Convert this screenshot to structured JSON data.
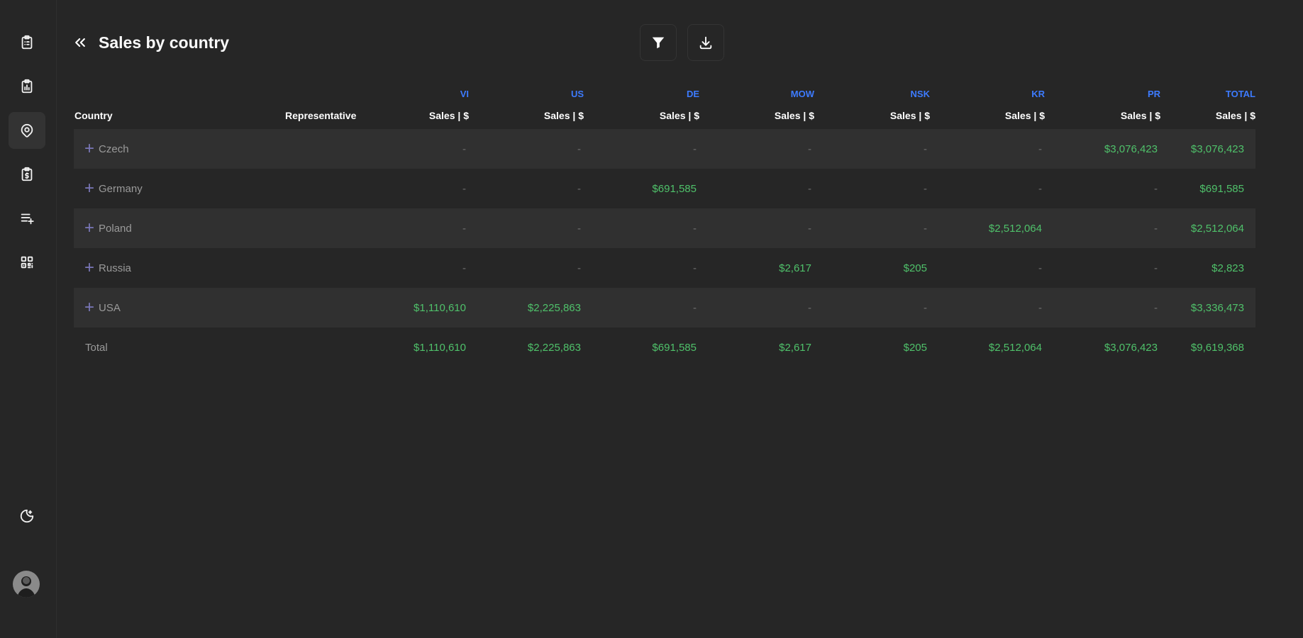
{
  "page": {
    "title": "Sales by country"
  },
  "sidebar": {
    "items": [
      {
        "icon": "clipboard-list-icon"
      },
      {
        "icon": "clipboard-chart-icon"
      },
      {
        "icon": "map-pin-icon",
        "active": true
      },
      {
        "icon": "clipboard-dollar-icon"
      },
      {
        "icon": "playlist-add-icon"
      },
      {
        "icon": "qr-code-icon"
      }
    ],
    "bottom": [
      {
        "icon": "moon-star-icon"
      }
    ]
  },
  "toolbar": {
    "filter_icon": "filter-icon",
    "download_icon": "download-icon"
  },
  "table": {
    "group_headers": [
      "VI",
      "US",
      "DE",
      "MOW",
      "NSK",
      "KR",
      "PR",
      "TOTAL"
    ],
    "country_header": "Country",
    "representative_header": "Representative",
    "measure_header": "Sales | $",
    "rows": [
      {
        "country": "Czech",
        "values": [
          "-",
          "-",
          "-",
          "-",
          "-",
          "-",
          "$3,076,423",
          "$3,076,423"
        ]
      },
      {
        "country": "Germany",
        "values": [
          "-",
          "-",
          "$691,585",
          "-",
          "-",
          "-",
          "-",
          "$691,585"
        ]
      },
      {
        "country": "Poland",
        "values": [
          "-",
          "-",
          "-",
          "-",
          "-",
          "$2,512,064",
          "-",
          "$2,512,064"
        ]
      },
      {
        "country": "Russia",
        "values": [
          "-",
          "-",
          "-",
          "$2,617",
          "$205",
          "-",
          "-",
          "$2,823"
        ]
      },
      {
        "country": "USA",
        "values": [
          "$1,110,610",
          "$2,225,863",
          "-",
          "-",
          "-",
          "-",
          "-",
          "$3,336,473"
        ]
      }
    ],
    "total": {
      "label": "Total",
      "values": [
        "$1,110,610",
        "$2,225,863",
        "$691,585",
        "$2,617",
        "$205",
        "$2,512,064",
        "$3,076,423",
        "$9,619,368"
      ]
    }
  },
  "colors": {
    "background": "#262626",
    "accent_blue": "#3d7bff",
    "value_green": "#4fc16a",
    "row_shade": "#303030"
  }
}
